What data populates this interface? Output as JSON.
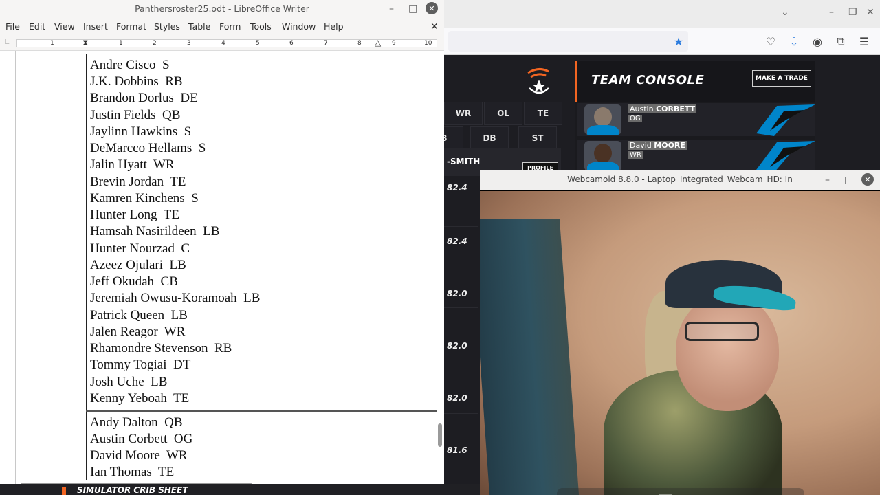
{
  "writer": {
    "title": "Panthersroster25.odt - LibreOffice Writer",
    "menus": [
      "File",
      "Edit",
      "View",
      "Insert",
      "Format",
      "Styles",
      "Table",
      "Form",
      "Tools",
      "Window",
      "Help"
    ],
    "ruler_ticks": [
      "1",
      "1",
      "2",
      "3",
      "4",
      "5",
      "6",
      "7",
      "8",
      "9",
      "10"
    ],
    "roster_section_1": [
      "Andre Cisco  S",
      "J.K. Dobbins  RB",
      "Brandon Dorlus  DE",
      "Justin Fields  QB",
      "Jaylinn Hawkins  S",
      "DeMarcco Hellams  S",
      "Jalin Hyatt  WR",
      "Brevin Jordan  TE",
      "Kamren Kinchens  S",
      "Hunter Long  TE",
      "Hamsah Nasirildeen  LB",
      "Hunter Nourzad  C",
      "Azeez Ojulari  LB",
      "Jeff Okudah  CB",
      "Jeremiah Owusu-Koramoah  LB",
      "Patrick Queen  LB",
      "Jalen Reagor  WR",
      "Rhamondre Stevenson  RB",
      "Tommy Togiai  DT",
      "Josh Uche  LB",
      "Kenny Yeboah  TE"
    ],
    "roster_section_2": [
      "Andy Dalton  QB",
      "Austin Corbett  OG",
      "David Moore  WR",
      "Ian Thomas  TE"
    ]
  },
  "browser": {
    "positions_row1": [
      "WR",
      "OL",
      "TE"
    ],
    "positions_row2": [
      "B",
      "DB",
      "ST"
    ],
    "player_strip_name": "-SMITH",
    "profile_label": "PROFILE",
    "ratings": [
      "82.4",
      "82.4",
      "82.0",
      "82.0",
      "82.0",
      "81.6"
    ],
    "console_title": "TEAM CONSOLE",
    "trade_button": "MAKE A TRADE",
    "players": [
      {
        "first": "Austin ",
        "last": "CORBETT",
        "pos": "OG"
      },
      {
        "first": "David ",
        "last": "MOORE",
        "pos": "WR"
      }
    ],
    "crib_text": "SIMULATOR CRIB SHEET"
  },
  "webcam": {
    "title": "Webcamoid 8.8.0 - Laptop_Integrated_Webcam_HD: In"
  },
  "colors": {
    "accent_orange": "#f26522",
    "panthers_blue": "#0085ca",
    "console_bg": "#1a1a1e"
  }
}
